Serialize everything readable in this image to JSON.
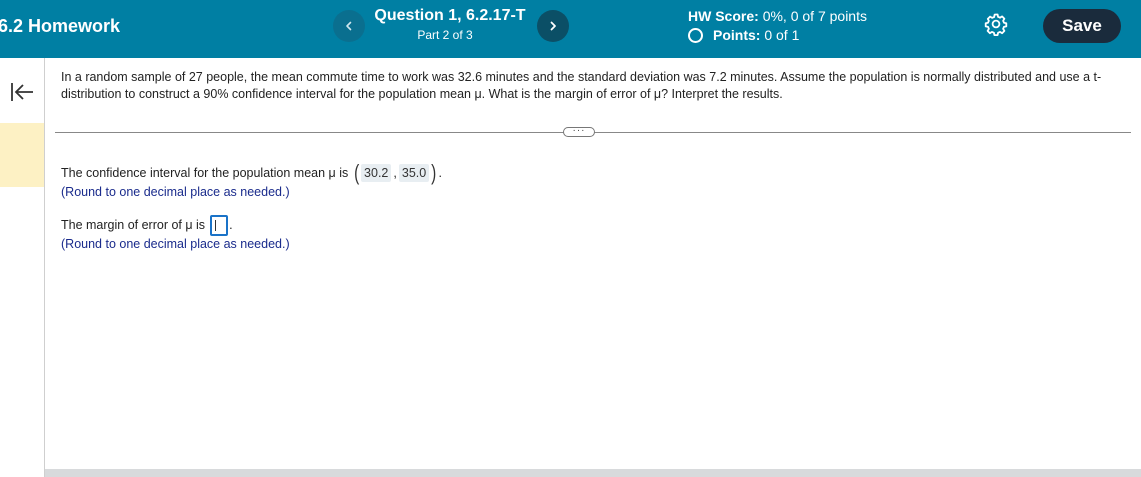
{
  "header": {
    "hw_title": "6.2 Homework",
    "question_title": "Question 1, 6.2.17-T",
    "question_part": "Part 2 of 3",
    "prev_label": "‹",
    "next_label": "›",
    "hw_score_label": "HW Score:",
    "hw_score_value": "0%, 0 of 7 points",
    "points_label": "Points:",
    "points_value": "0 of 1",
    "save_label": "Save"
  },
  "question": {
    "text": "In a random sample of 27 people, the mean commute time to work was 32.6 minutes and the standard deviation was 7.2 minutes. Assume the population is normally distributed and use a t-distribution to construct a 90% confidence interval for the population mean μ. What is the margin of error of μ? Interpret the results."
  },
  "answer": {
    "ci_prefix": "The confidence interval for the population mean μ is",
    "ci_lower": "30.2",
    "ci_upper": "35.0",
    "ci_separator": ",",
    "ci_suffix": ".",
    "ci_hint": "(Round to one decimal place as needed.)",
    "moe_prefix": "The margin of error of μ is",
    "moe_value": "",
    "moe_suffix": ".",
    "moe_hint": "(Round to one decimal place as needed.)"
  },
  "colors": {
    "header_bg": "#007fa3",
    "save_bg": "#1a2b3c",
    "hint_text": "#1a2b8c",
    "input_border": "#1a73c8",
    "rail_highlight": "#fdf1c4"
  },
  "icons": {
    "prev": "chevron-left-icon",
    "next": "chevron-right-icon",
    "points_status": "circle-outline-icon",
    "settings": "gear-icon",
    "collapse": "collapse-left-icon",
    "expand": "ellipsis-icon"
  }
}
